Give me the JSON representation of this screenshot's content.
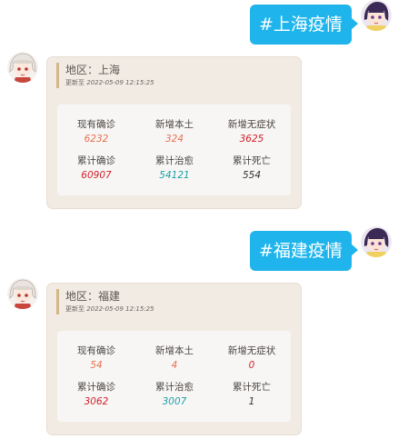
{
  "colors": {
    "bubble": "#1fb5ec",
    "card_bg": "#f2ebe4",
    "accent_bar": "#d2b886",
    "salmon": "#e9704f",
    "red": "#d3202a",
    "teal": "#1aa1a6",
    "dark": "#333333"
  },
  "messages": [
    {
      "user_text": "#上海疫情",
      "user_avatar_icon": "purple-hair-anime-avatar-icon",
      "bot_avatar_icon": "white-hair-anime-avatar-icon",
      "card": {
        "region": "地区：上海",
        "updated_label": "更新至",
        "updated_time": "2022-05-09 12:15:25",
        "stats": [
          {
            "label": "现有确诊",
            "value": "6232",
            "color": "#e9704f"
          },
          {
            "label": "新增本土",
            "value": "324",
            "color": "#e9704f"
          },
          {
            "label": "新增无症状",
            "value": "3625",
            "color": "#d3202a"
          },
          {
            "label": "累计确诊",
            "value": "60907",
            "color": "#d3202a"
          },
          {
            "label": "累计治愈",
            "value": "54121",
            "color": "#1aa1a6"
          },
          {
            "label": "累计死亡",
            "value": "554",
            "color": "#333333"
          }
        ]
      }
    },
    {
      "user_text": "#福建疫情",
      "user_avatar_icon": "purple-hair-anime-avatar-icon",
      "bot_avatar_icon": "white-hair-anime-avatar-icon",
      "card": {
        "region": "地区：福建",
        "updated_label": "更新至",
        "updated_time": "2022-05-09 12:15:25",
        "stats": [
          {
            "label": "现有确诊",
            "value": "54",
            "color": "#e9704f"
          },
          {
            "label": "新增本土",
            "value": "4",
            "color": "#e9704f"
          },
          {
            "label": "新增无症状",
            "value": "0",
            "color": "#d3202a"
          },
          {
            "label": "累计确诊",
            "value": "3062",
            "color": "#d3202a"
          },
          {
            "label": "累计治愈",
            "value": "3007",
            "color": "#1aa1a6"
          },
          {
            "label": "累计死亡",
            "value": "1",
            "color": "#333333"
          }
        ]
      }
    }
  ]
}
